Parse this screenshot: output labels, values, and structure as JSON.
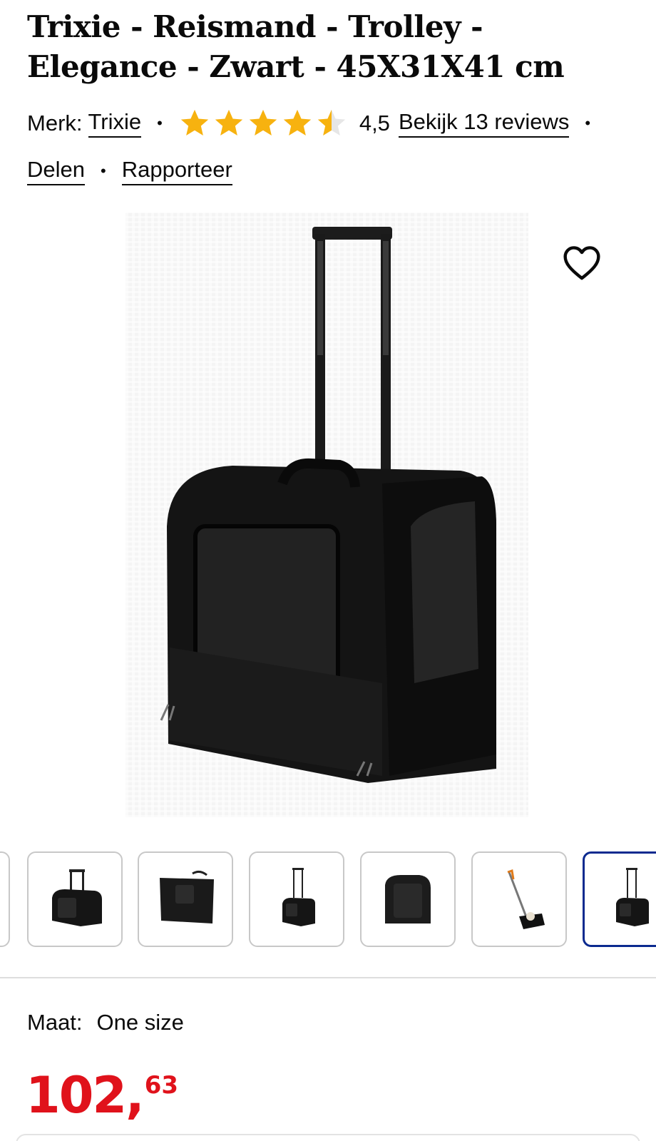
{
  "product": {
    "title_line1": "Trixie - Reismand - Trolley -",
    "title_line2": "Elegance - Zwart - 45X31X41 cm"
  },
  "meta": {
    "brand_label": "Merk:",
    "brand_link": "Trixie",
    "rating_value": "4,5",
    "rating_stars": 4.5,
    "reviews_link": "Bekijk 13 reviews",
    "share_link": "Delen",
    "report_link": "Rapporteer",
    "separator": "•"
  },
  "gallery": {
    "main_image": "product-photo",
    "favorite_icon": "heart-outline-icon",
    "thumbnails_count": 7,
    "active_thumbnail": 7
  },
  "variant": {
    "size_label": "Maat:",
    "size_value": "One size"
  },
  "price": {
    "whole": "102",
    "separator": ",",
    "cents": "63"
  },
  "colors": {
    "price": "#e0121b",
    "star": "#f7b20f",
    "active_thumb_border": "#0b2a8f"
  }
}
